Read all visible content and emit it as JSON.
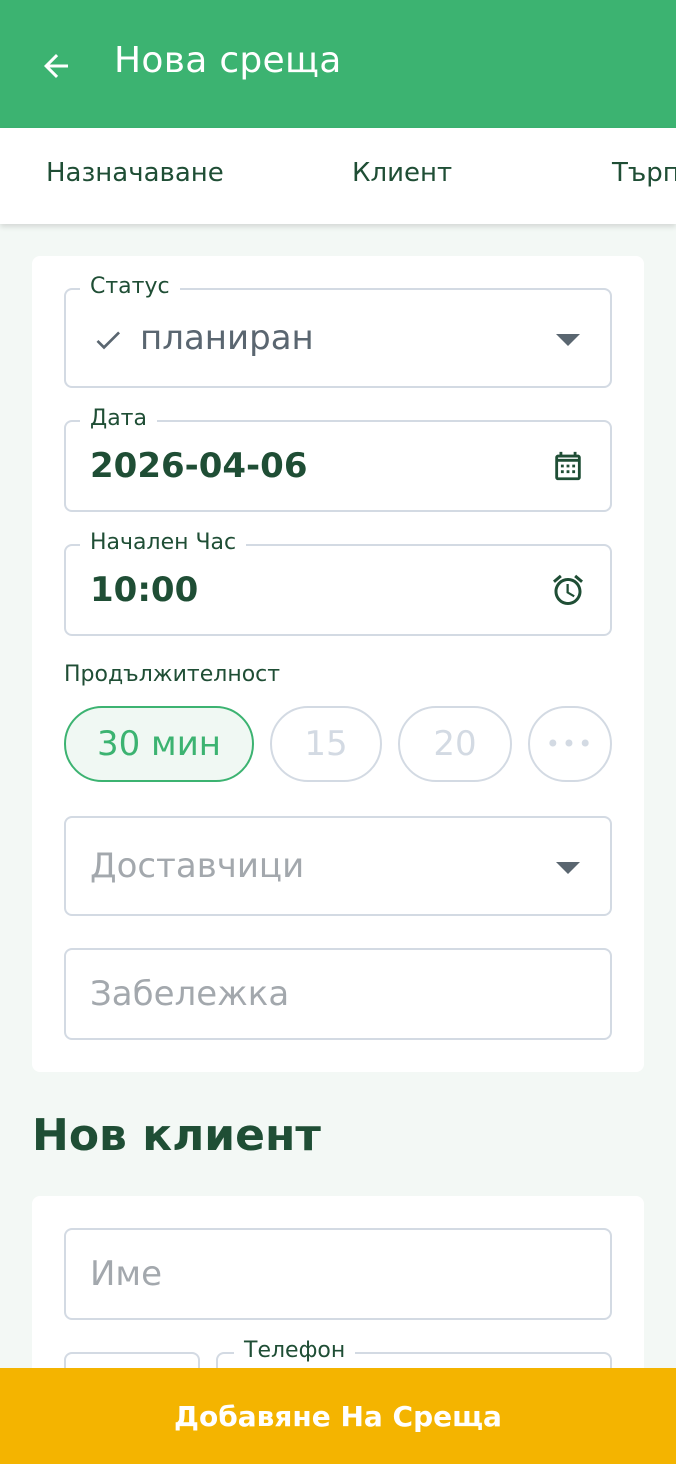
{
  "appbar": {
    "title": "Нова среща"
  },
  "tabs": [
    {
      "label": "Назначаване"
    },
    {
      "label": "Клиент"
    },
    {
      "label": "Търп"
    }
  ],
  "form": {
    "status": {
      "label": "Статус",
      "value": "планиран"
    },
    "date": {
      "label": "Дата",
      "value": "2026-04-06"
    },
    "start_time": {
      "label": "Начален Час",
      "value": "10:00"
    },
    "duration": {
      "label": "Продължителност",
      "options": [
        "30 мин",
        "15",
        "20"
      ],
      "more": "•••",
      "selected": "30 мин"
    },
    "suppliers": {
      "placeholder": "Доставчици"
    },
    "note": {
      "placeholder": "Забележка"
    }
  },
  "new_client": {
    "title": "Нов клиент",
    "name": {
      "placeholder": "Име"
    },
    "phone": {
      "label": "Телефон"
    }
  },
  "submit": {
    "label": "Добавяне На Среща"
  },
  "colors": {
    "primary": "#3cb371",
    "accent": "#f4b400",
    "text_dark": "#1f4e35",
    "border": "#d3dae3"
  }
}
